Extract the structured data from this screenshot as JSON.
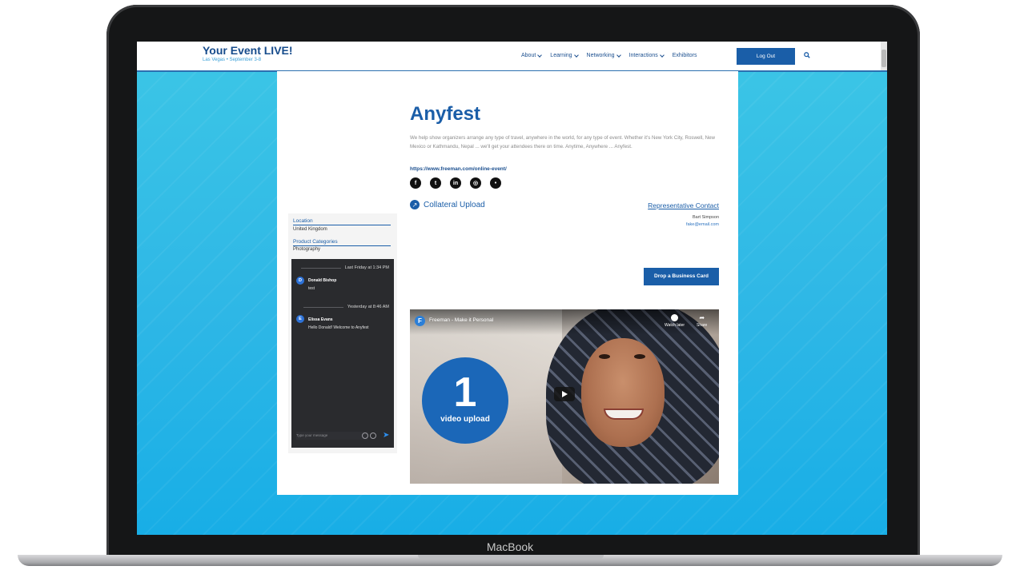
{
  "device": {
    "label": "MacBook"
  },
  "header": {
    "brand": "Your Event LIVE!",
    "tagline": "Las Vegas • September 3-8",
    "nav": [
      "About",
      "Learning",
      "Networking",
      "Interactions",
      "Exhibitors"
    ],
    "logout_label": "Log Out"
  },
  "exhibitor": {
    "name": "Anyfest",
    "description": "We help show organizers arrange any type of travel, anywhere in the world, for any type of event. Whether it's New York City, Roswell, New Mexico or Kathmandu, Nepal ... we'll get your attendees there on time. Anytime, Anywhere ... Anyfest.",
    "website": "https://www.freeman.com/online-event/",
    "socials": [
      "facebook",
      "twitter",
      "linkedin",
      "instagram",
      "more"
    ],
    "collateral_label": "Collateral Upload",
    "rep_heading": "Representative Contact",
    "rep_name": "Bart Simpson",
    "rep_email": "fake@email.com",
    "drop_card_label": "Drop a Business Card"
  },
  "sidebar": {
    "location_label": "Location",
    "location_value": "United Kingdom",
    "categories_label": "Product Categories",
    "categories_value": "Photography"
  },
  "chat": {
    "messages": [
      {
        "timestamp": "Last Friday at 1:34 PM",
        "initial": "D",
        "author": "Donald Bishop",
        "text": "test"
      },
      {
        "timestamp": "Yesterday at 8:46 AM",
        "initial": "E",
        "author": "Elissa Evans",
        "text": "Hello Donald! Welcome to Anyfest"
      }
    ],
    "input_placeholder": "Type your message"
  },
  "video": {
    "channel_initial": "F",
    "title": "Freeman - Make it Personal",
    "watch_later": "Watch later",
    "share": "Share",
    "badge_number": "1",
    "badge_label": "video upload"
  }
}
